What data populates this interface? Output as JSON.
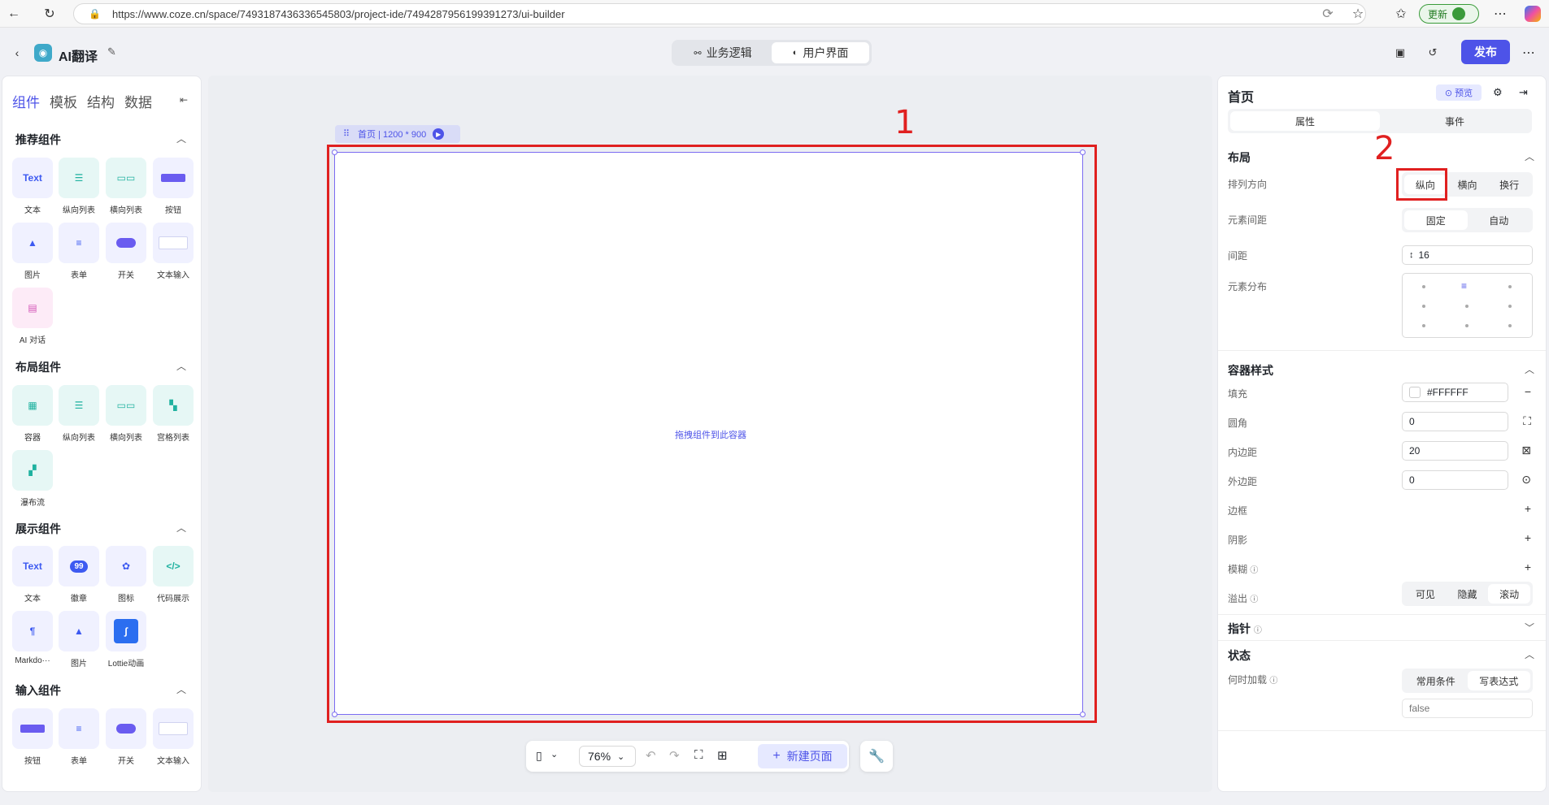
{
  "browser": {
    "url": "https://www.coze.cn/space/7493187436336545803/project-ide/7494287956199391273/ui-builder",
    "update_label": "更新"
  },
  "header": {
    "app_name": "AI翻译",
    "tabs": [
      {
        "label": "业务逻辑"
      },
      {
        "label": "用户界面"
      }
    ],
    "active_tab": "用户界面",
    "publish_label": "发布"
  },
  "left": {
    "tabs": [
      "组件",
      "模板",
      "结构",
      "数据"
    ],
    "sections": {
      "recommended": {
        "title": "推荐组件",
        "items": [
          "文本",
          "纵向列表",
          "横向列表",
          "按钮",
          "图片",
          "表单",
          "开关",
          "文本输入",
          "AI 对话"
        ]
      },
      "layout": {
        "title": "布局组件",
        "items": [
          "容器",
          "纵向列表",
          "横向列表",
          "宫格列表",
          "瀑布流"
        ]
      },
      "display": {
        "title": "展示组件",
        "items": [
          "文本",
          "徽章",
          "图标",
          "代码展示",
          "Markdo···",
          "图片",
          "Lottie动画"
        ]
      },
      "input": {
        "title": "输入组件",
        "items": [
          "按钮",
          "表单",
          "开关",
          "文本输入"
        ]
      }
    },
    "icon_text": "Text",
    "badge_count": "99"
  },
  "canvas": {
    "page_label": "首页 | 1200 * 900",
    "drop_hint": "拖拽组件到此容器",
    "annotation_1": "1",
    "annotation_2": "2"
  },
  "toolbar": {
    "zoom": "76%",
    "new_page_label": "新建页面"
  },
  "right": {
    "title": "首页",
    "preview_label": "预览",
    "tabs": [
      "属性",
      "事件"
    ],
    "layout": {
      "title": "布局",
      "direction_label": "排列方向",
      "direction_options": [
        "纵向",
        "横向",
        "换行"
      ],
      "gap_mode_label": "元素间距",
      "gap_mode_options": [
        "固定",
        "自动"
      ],
      "gap_label": "间距",
      "gap_value": "16",
      "distribution_label": "元素分布"
    },
    "container": {
      "title": "容器样式",
      "fill_label": "填充",
      "fill_value": "#FFFFFF",
      "radius_label": "圆角",
      "radius_value": "0",
      "padding_label": "内边距",
      "padding_value": "20",
      "margin_label": "外边距",
      "margin_value": "0",
      "border_label": "边框",
      "shadow_label": "阴影",
      "blur_label": "模糊",
      "overflow_label": "溢出",
      "overflow_options": [
        "可见",
        "隐藏",
        "滚动"
      ]
    },
    "pointer_title": "指针",
    "state": {
      "title": "状态",
      "load_label": "何时加载",
      "load_options": [
        "常用条件",
        "写表达式"
      ],
      "expr_placeholder": "false"
    }
  },
  "colors": {
    "accent": "#4d53e8",
    "annotation": "#e02020"
  }
}
